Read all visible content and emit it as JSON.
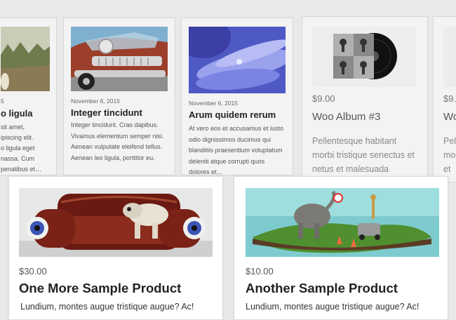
{
  "posts": [
    {
      "date": "",
      "title": "o ligula",
      "excerpt": ""
    },
    {
      "date": "November 6, 2015",
      "title": "Integer tincidunt",
      "excerpt": "Integer tincidunt. Cras dapibus. Vivamus elementum semper nisi. Aenean vulputate eleifend tellus. Aenean leo ligula, porttitor eu."
    },
    {
      "date": "November 6, 2015",
      "title": "Arum quidem rerum",
      "excerpt": "At vero eos et accusamus et iusto odio dignissimos ducimus qui blanditiis praesentium voluptatum deleniti atque corrupti quos dolores et…"
    }
  ],
  "left_partial_lines": [
    "5",
    "sit amet,",
    "ipiscing elit.",
    "o ligula eget",
    "nassa. Cum",
    "penatibus et…"
  ],
  "album": {
    "price": "$9.00",
    "name": "Woo Album #3",
    "description": "Pellentesque habitant morbi tristique senectus et netus et malesuada"
  },
  "right_partial": {
    "price": "$9.",
    "name": "Wo",
    "desc_lines": [
      "Pel",
      "mo",
      "et"
    ]
  },
  "featured": [
    {
      "price": "$30.00",
      "name": "One More Sample Product",
      "description": "Lundium, montes augue tristique augue? Ac!"
    },
    {
      "price": "$10.00",
      "name": "Another Sample Product",
      "description": "Lundium, montes augue tristique augue? Ac!"
    }
  ],
  "icons": {
    "post_images": [
      "forest-photo-icon",
      "classic-car-photo-icon",
      "purple-flower-photo-icon"
    ],
    "album_image": "vinyl-record-icon",
    "featured_images": [
      "red-armchair-dog-photo-icon",
      "elephant-island-photo-icon"
    ]
  }
}
